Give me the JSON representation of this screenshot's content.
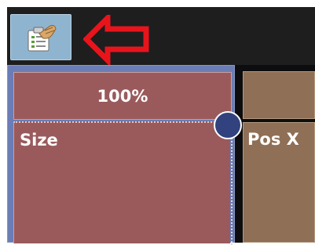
{
  "toolbar": {
    "tool_icon": "clipboard-hand-icon",
    "annotation": "red-arrow-left"
  },
  "track": {
    "zoom_label": "100%",
    "size_label": "Size",
    "pos_x_label": "Pos X"
  },
  "colors": {
    "toolbar_bg": "#1e1e1e",
    "button_bg": "#8fb4cf",
    "size_cell": "#9a5a5c",
    "pos_cell": "#8f6f55",
    "knob": "#31427e",
    "annotation_red": "#e8141c"
  }
}
